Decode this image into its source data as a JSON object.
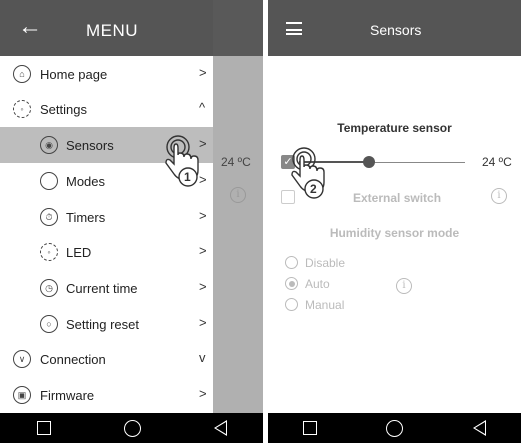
{
  "left_screen": {
    "header": {
      "title": "MENU"
    },
    "menu": [
      {
        "label": "Home page",
        "chevron": ">"
      },
      {
        "label": "Settings",
        "chevron": "^"
      },
      {
        "label": "Sensors",
        "chevron": ">"
      },
      {
        "label": "Modes",
        "chevron": ">"
      },
      {
        "label": "Timers",
        "chevron": ">"
      },
      {
        "label": "LED",
        "chevron": ">"
      },
      {
        "label": "Current time",
        "chevron": ">"
      },
      {
        "label": "Setting reset",
        "chevron": ">"
      },
      {
        "label": "Connection",
        "chevron": "v"
      },
      {
        "label": "Firmware",
        "chevron": ">"
      }
    ],
    "background_temp": "24 ºC",
    "step": "1"
  },
  "right_screen": {
    "header": {
      "title": "Sensors"
    },
    "temperature_sensor": {
      "title": "Temperature sensor",
      "value": "24 ºC",
      "checked": true,
      "level_fraction": 0.4
    },
    "external_switch": {
      "label": "External switch",
      "checked": false
    },
    "humidity": {
      "title": "Humidity sensor mode",
      "options": [
        "Disable",
        "Auto",
        "Manual"
      ],
      "selected": "Auto"
    },
    "step": "2"
  },
  "icons": {
    "back": "arrow-left-icon",
    "menu": "hamburger-icon",
    "info": "info-icon"
  }
}
